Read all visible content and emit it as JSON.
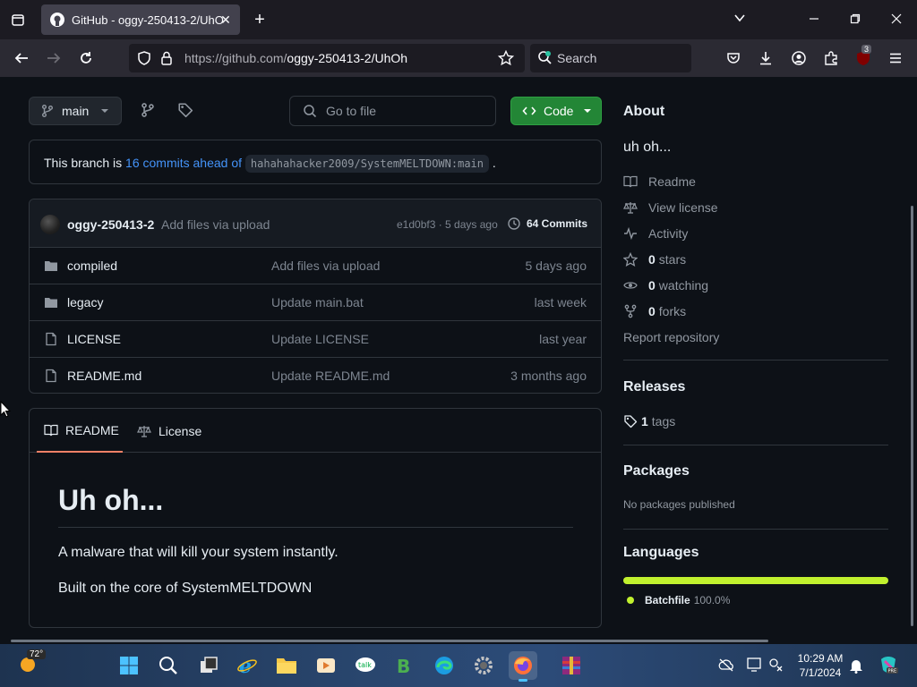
{
  "browser": {
    "tab_title": "GitHub - oggy-250413-2/UhOh",
    "url_domain": "https://github.com/",
    "url_path": "oggy-250413-2/UhOh",
    "search_label": "Search",
    "extension_badge": "3"
  },
  "repo": {
    "branch": "main",
    "go_to_file_placeholder": "Go to file",
    "code_button": "Code",
    "branch_notice": {
      "prefix": "This branch is",
      "commits_link": "16 commits ahead of",
      "upstream": "hahahahacker2009/SystemMELTDOWN:main",
      "suffix": "."
    },
    "last_commit": {
      "author": "oggy-250413-2",
      "message": "Add files via upload",
      "sha_date": "e1d0bf3 · 5 days ago",
      "commits": "64 Commits"
    },
    "files": [
      {
        "name": "compiled",
        "type": "folder",
        "message": "Add files via upload",
        "date": "5 days ago"
      },
      {
        "name": "legacy",
        "type": "folder",
        "message": "Update main.bat",
        "date": "last week"
      },
      {
        "name": "LICENSE",
        "type": "file",
        "message": "Update LICENSE",
        "date": "last year"
      },
      {
        "name": "README.md",
        "type": "file",
        "message": "Update README.md",
        "date": "3 months ago"
      }
    ],
    "readme_tabs": [
      "README",
      "License"
    ],
    "readme": {
      "heading": "Uh oh...",
      "para1": "A malware that will kill your system instantly.",
      "para2": "Built on the core of SystemMELTDOWN"
    }
  },
  "about": {
    "title": "About",
    "description": "uh oh...",
    "readme": "Readme",
    "license": "View license",
    "activity": "Activity",
    "stars_count": "0",
    "stars_label": "stars",
    "watching_count": "0",
    "watching_label": "watching",
    "forks_count": "0",
    "forks_label": "forks",
    "report": "Report repository"
  },
  "releases": {
    "title": "Releases",
    "tags_count": "1",
    "tags_label": "tags"
  },
  "packages": {
    "title": "Packages",
    "empty": "No packages published"
  },
  "languages": {
    "title": "Languages",
    "items": [
      {
        "name": "Batchfile",
        "percent": "100.0%",
        "color": "#c1f12e"
      }
    ]
  },
  "taskbar": {
    "weather_temp": "72°",
    "time": "10:29 AM",
    "date": "7/1/2024"
  }
}
